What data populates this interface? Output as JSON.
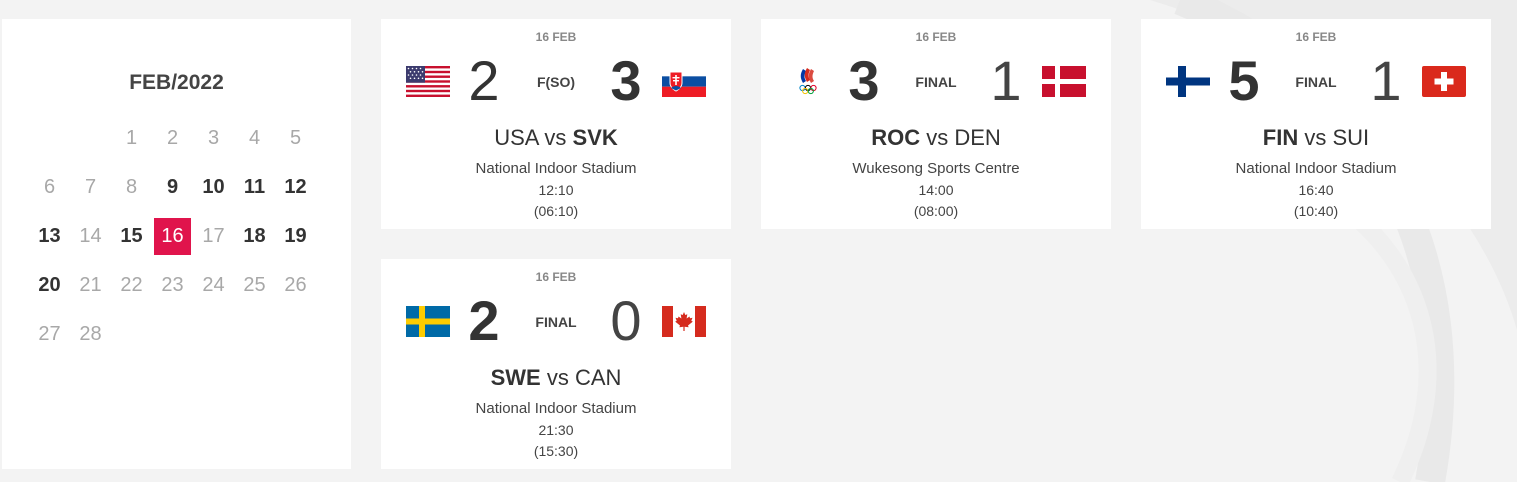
{
  "calendar": {
    "title": "FEB/2022",
    "rows": [
      [
        null,
        null,
        {
          "d": "1",
          "s": "muted"
        },
        {
          "d": "2",
          "s": "muted"
        },
        {
          "d": "3",
          "s": "muted"
        },
        {
          "d": "4",
          "s": "muted"
        },
        {
          "d": "5",
          "s": "muted"
        }
      ],
      [
        {
          "d": "6",
          "s": "muted"
        },
        {
          "d": "7",
          "s": "muted"
        },
        {
          "d": "8",
          "s": "muted"
        },
        {
          "d": "9",
          "s": "active"
        },
        {
          "d": "10",
          "s": "active"
        },
        {
          "d": "11",
          "s": "active"
        },
        {
          "d": "12",
          "s": "active"
        }
      ],
      [
        {
          "d": "13",
          "s": "active"
        },
        {
          "d": "14",
          "s": "muted"
        },
        {
          "d": "15",
          "s": "active"
        },
        {
          "d": "16",
          "s": "selected"
        },
        {
          "d": "17",
          "s": "muted"
        },
        {
          "d": "18",
          "s": "active"
        },
        {
          "d": "19",
          "s": "active"
        }
      ],
      [
        {
          "d": "20",
          "s": "active"
        },
        {
          "d": "21",
          "s": "muted"
        },
        {
          "d": "22",
          "s": "muted"
        },
        {
          "d": "23",
          "s": "muted"
        },
        {
          "d": "24",
          "s": "muted"
        },
        {
          "d": "25",
          "s": "muted"
        },
        {
          "d": "26",
          "s": "muted"
        }
      ],
      [
        {
          "d": "27",
          "s": "muted"
        },
        {
          "d": "28",
          "s": "muted"
        },
        null,
        null,
        null,
        null,
        null
      ]
    ]
  },
  "matches": [
    {
      "date": "16 FEB",
      "home": {
        "code": "USA",
        "score": "2",
        "flag": "usa-flag-icon",
        "winner": false
      },
      "away": {
        "code": "SVK",
        "score": "3",
        "flag": "svk-flag-icon",
        "winner": true
      },
      "status": "F(SO)",
      "vs": "vs",
      "venue": "National Indoor Stadium",
      "time_local": "12:10",
      "time_other": "(06:10)"
    },
    {
      "date": "16 FEB",
      "home": {
        "code": "ROC",
        "score": "3",
        "flag": "roc-olympic-flag-icon",
        "winner": true
      },
      "away": {
        "code": "DEN",
        "score": "1",
        "flag": "den-flag-icon",
        "winner": false
      },
      "status": "FINAL",
      "vs": "vs",
      "venue": "Wukesong Sports Centre",
      "time_local": "14:00",
      "time_other": "(08:00)"
    },
    {
      "date": "16 FEB",
      "home": {
        "code": "FIN",
        "score": "5",
        "flag": "fin-flag-icon",
        "winner": true
      },
      "away": {
        "code": "SUI",
        "score": "1",
        "flag": "sui-flag-icon",
        "winner": false
      },
      "status": "FINAL",
      "vs": "vs",
      "venue": "National Indoor Stadium",
      "time_local": "16:40",
      "time_other": "(10:40)"
    },
    {
      "date": "16 FEB",
      "home": {
        "code": "SWE",
        "score": "2",
        "flag": "swe-flag-icon",
        "winner": true
      },
      "away": {
        "code": "CAN",
        "score": "0",
        "flag": "can-flag-icon",
        "winner": false
      },
      "status": "FINAL",
      "vs": "vs",
      "venue": "National Indoor Stadium",
      "time_local": "21:30",
      "time_other": "(15:30)"
    }
  ],
  "colors": {
    "selected_day": "#e0144c",
    "background": "#f3f3f3",
    "card": "#ffffff"
  }
}
